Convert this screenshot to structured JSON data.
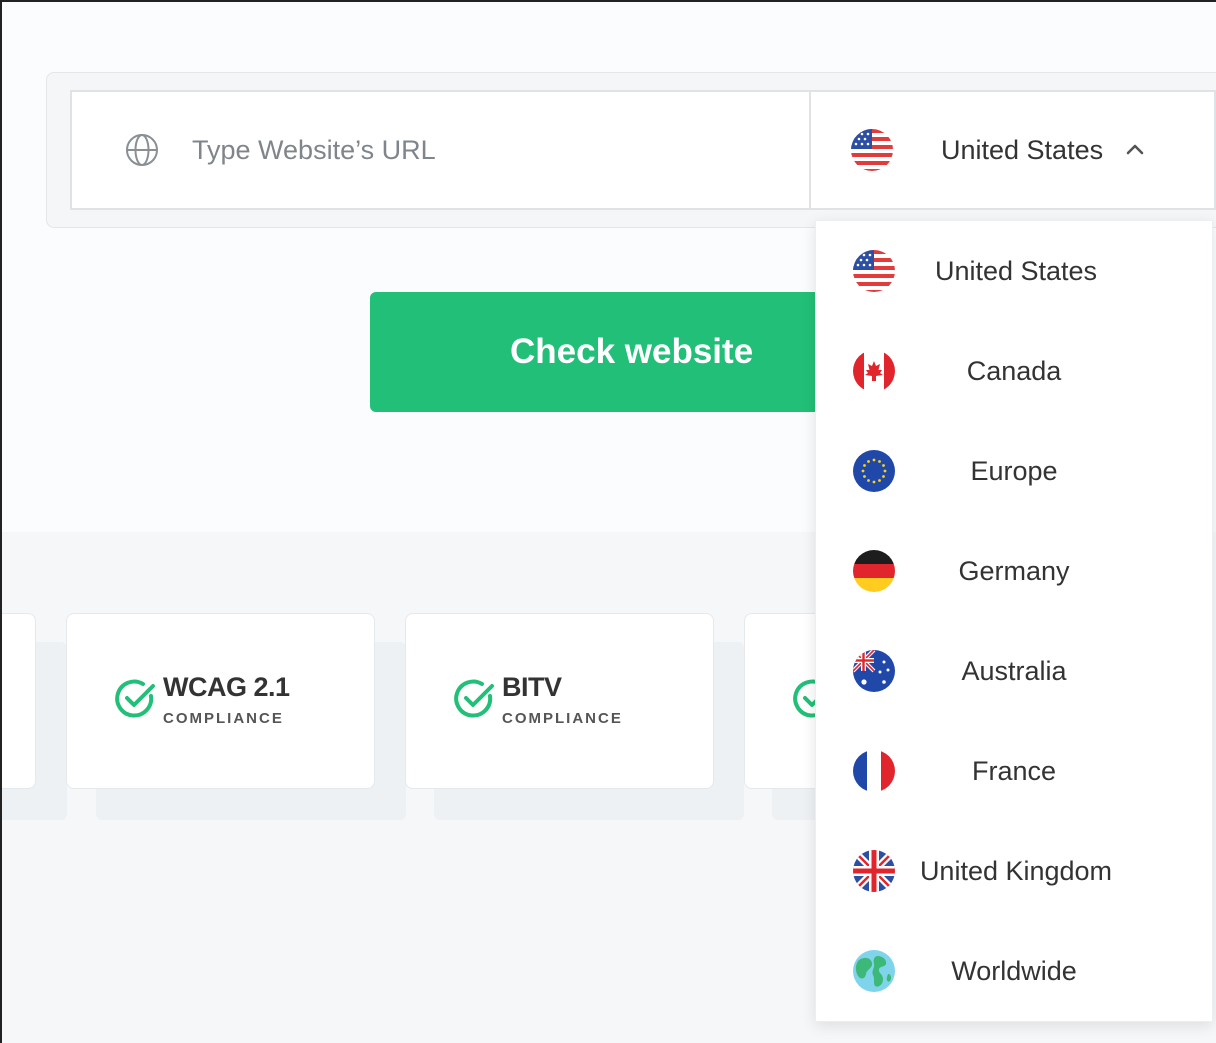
{
  "search": {
    "url_placeholder": "Type Website’s URL",
    "selected_country": "United States"
  },
  "check_button": {
    "label": "Check website"
  },
  "cards": [
    {
      "title": "WCAG 2.1",
      "subtitle": "COMPLIANCE"
    },
    {
      "title": "BITV",
      "subtitle": "COMPLIANCE"
    }
  ],
  "dropdown": {
    "items": [
      {
        "label": "United States",
        "flag": "us-flag-icon"
      },
      {
        "label": "Canada",
        "flag": "canada-flag-icon"
      },
      {
        "label": "Europe",
        "flag": "eu-flag-icon"
      },
      {
        "label": "Germany",
        "flag": "germany-flag-icon"
      },
      {
        "label": "Australia",
        "flag": "australia-flag-icon"
      },
      {
        "label": "France",
        "flag": "france-flag-icon"
      },
      {
        "label": "United Kingdom",
        "flag": "uk-flag-icon"
      },
      {
        "label": "Worldwide",
        "flag": "globe-earth-icon"
      }
    ]
  },
  "colors": {
    "accent_green": "#22bf78",
    "check_green": "#22bf78",
    "text": "#333333",
    "placeholder": "#7f858b"
  }
}
